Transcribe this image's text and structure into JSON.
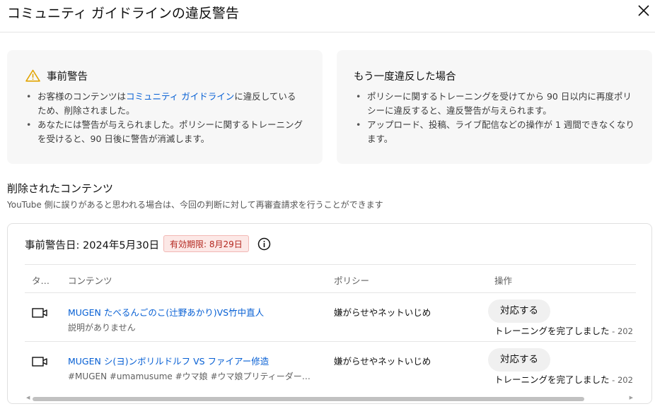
{
  "header": {
    "title": "コミュニティ ガイドラインの違反警告",
    "close_icon": "close-icon"
  },
  "warning_panel": {
    "icon": "warning-icon",
    "title": "事前警告",
    "bullet1_pre": "お客様のコンテンツは",
    "bullet1_link": "コミュニティ ガイドライン",
    "bullet1_post": "に違反しているため、削除されました。",
    "bullet2": "あなたには警告が与えられました。ポリシーに関するトレーニングを受けると、90 日後に警告が消滅します。"
  },
  "repeat_panel": {
    "title": "もう一度違反した場合",
    "bullets": [
      "ポリシーに関するトレーニングを受けてから 90 日以内に再度ポリシーに違反すると、違反警告が与えられます。",
      "アップロード、投稿、ライブ配信などの操作が 1 週間できなくなります。"
    ]
  },
  "removed": {
    "title": "削除されたコンテンツ",
    "description": "YouTube 側に誤りがあると思われる場合は、今回の判断に対して再審査請求を行うことができます"
  },
  "card": {
    "date_label": "事前警告日: 2024年5月30日",
    "expiry_badge": "有効期限: 8月29日",
    "info_icon": "info-icon",
    "columns": [
      "タ…",
      "コンテンツ",
      "ポリシー",
      "操作"
    ],
    "rows": [
      {
        "icon": "video-icon",
        "title": "MUGEN たべるんごのこ(辻野あかり)VS竹中直人",
        "subtitle": "説明がありません",
        "policy": "嫌がらせやネットいじめ",
        "action": "対応する",
        "status": "トレーニングを完了しました",
        "status_date": " - 202"
      },
      {
        "icon": "video-icon",
        "title": "MUGEN シ(ヨ)ンボリルドルフ VS ファイアー修造",
        "subtitle": "#MUGEN #umamusume #ウマ娘 #ウマ娘プリティーダービー …",
        "policy": "嫌がらせやネットいじめ",
        "action": "対応する",
        "status": "トレーニングを完了しました",
        "status_date": " - 202"
      }
    ]
  }
}
